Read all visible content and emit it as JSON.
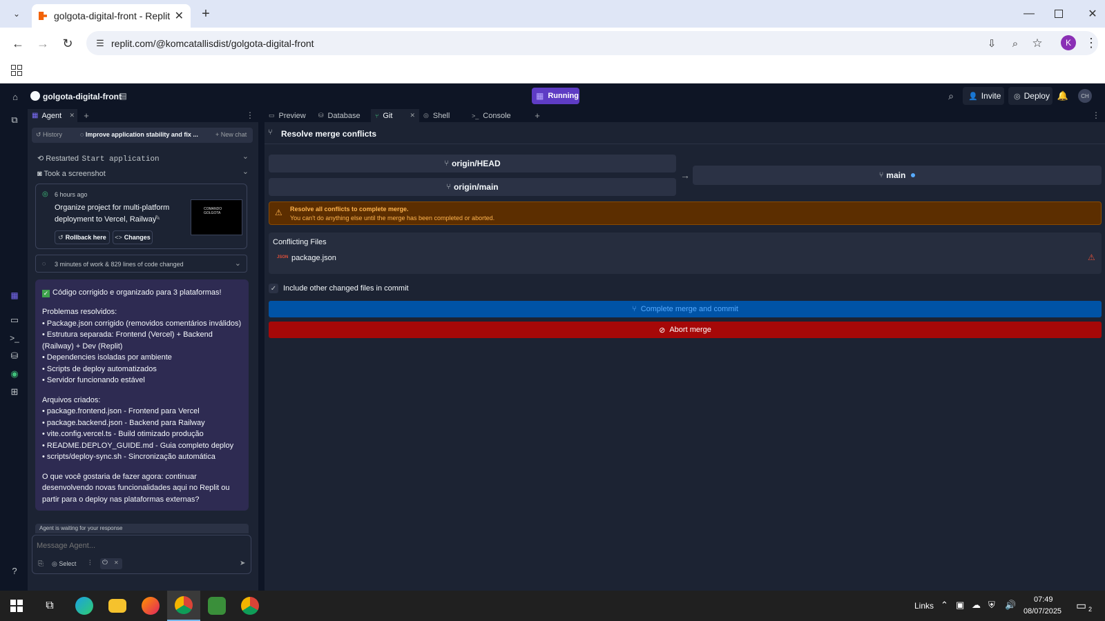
{
  "browser": {
    "tab_title": "golgota-digital-front - Replit",
    "url": "replit.com/@komcatallisdist/golgota-digital-front",
    "profile_initial": "K"
  },
  "topbar": {
    "repl_name": "golgota-digital-front",
    "run_status": "Running",
    "invite_label": "Invite",
    "deploy_label": "Deploy",
    "avatar_initials": "CH"
  },
  "agent": {
    "tab_label": "Agent",
    "history_label": "History",
    "chat_title": "Improve application stability and fix ...",
    "new_chat_label": "New chat",
    "restarted_label": "Restarted",
    "restarted_target": "Start application",
    "screenshot_label": "Took a screenshot",
    "checkpoint": {
      "time": "6 hours ago",
      "title": "Organize project for multi-platform deployment to Vercel, Railway",
      "rollback_label": "Rollback here",
      "changes_label": "Changes",
      "thumb_text_1": "COMANDO",
      "thumb_text_2": "GOLGOTA"
    },
    "work_summary": "3 minutes of work & 829 lines of code changed",
    "message": {
      "headline": "Código corrigido e organizado para 3 plataformas!",
      "section1_title": "Problemas resolvidos:",
      "section1_items": [
        "• Package.json corrigido (removidos comentários inválidos)",
        "• Estrutura separada: Frontend (Vercel) + Backend (Railway) + Dev (Replit)",
        "• Dependencies isoladas por ambiente",
        "• Scripts de deploy automatizados",
        "• Servidor funcionando estável"
      ],
      "section2_title": "Arquivos criados:",
      "section2_items": [
        "• package.frontend.json - Frontend para Vercel",
        "• package.backend.json - Backend para Railway",
        "• vite.config.vercel.ts - Build otimizado produção",
        "• README.DEPLOY_GUIDE.md - Guia completo deploy",
        "• scripts/deploy-sync.sh - Sincronização automática"
      ],
      "question": "O que você gostaria de fazer agora: continuar desenvolvendo novas funcionalidades aqui no Replit ou partir para o deploy nas plataformas externas?"
    },
    "waiting_text": "Agent is waiting for your response",
    "input_placeholder": "Message Agent...",
    "select_label": "Select"
  },
  "tabs": [
    {
      "label": "Preview"
    },
    {
      "label": "Database"
    },
    {
      "label": "Git"
    },
    {
      "label": "Shell"
    },
    {
      "label": "Console"
    }
  ],
  "git": {
    "header": "Resolve merge conflicts",
    "source_branch_1": "origin/HEAD",
    "source_branch_2": "origin/main",
    "target_branch": "main",
    "warning_title": "Resolve all conflicts to complete merge.",
    "warning_body": "You can't do anything else until the merge has been completed or aborted.",
    "conflicting_files_title": "Conflicting Files",
    "file_badge": "JSON",
    "conflict_file": "package.json",
    "include_label": "Include other changed files in commit",
    "complete_label": "Complete merge and commit",
    "abort_label": "Abort merge"
  },
  "taskbar": {
    "links_label": "Links",
    "time": "07:49",
    "date": "08/07/2025",
    "notification_count": "2"
  },
  "colors": {
    "replit_bg": "#0e1525",
    "panel_bg": "#1c2333",
    "card_bg": "#2b3245",
    "running": "#7b3fe4",
    "complete_btn": "#0053a6",
    "abort_btn": "#a60808",
    "warning_bg": "#5c2e00",
    "warning_text": "#ffb44d",
    "agent_msg_bg": "#2e2b52"
  }
}
